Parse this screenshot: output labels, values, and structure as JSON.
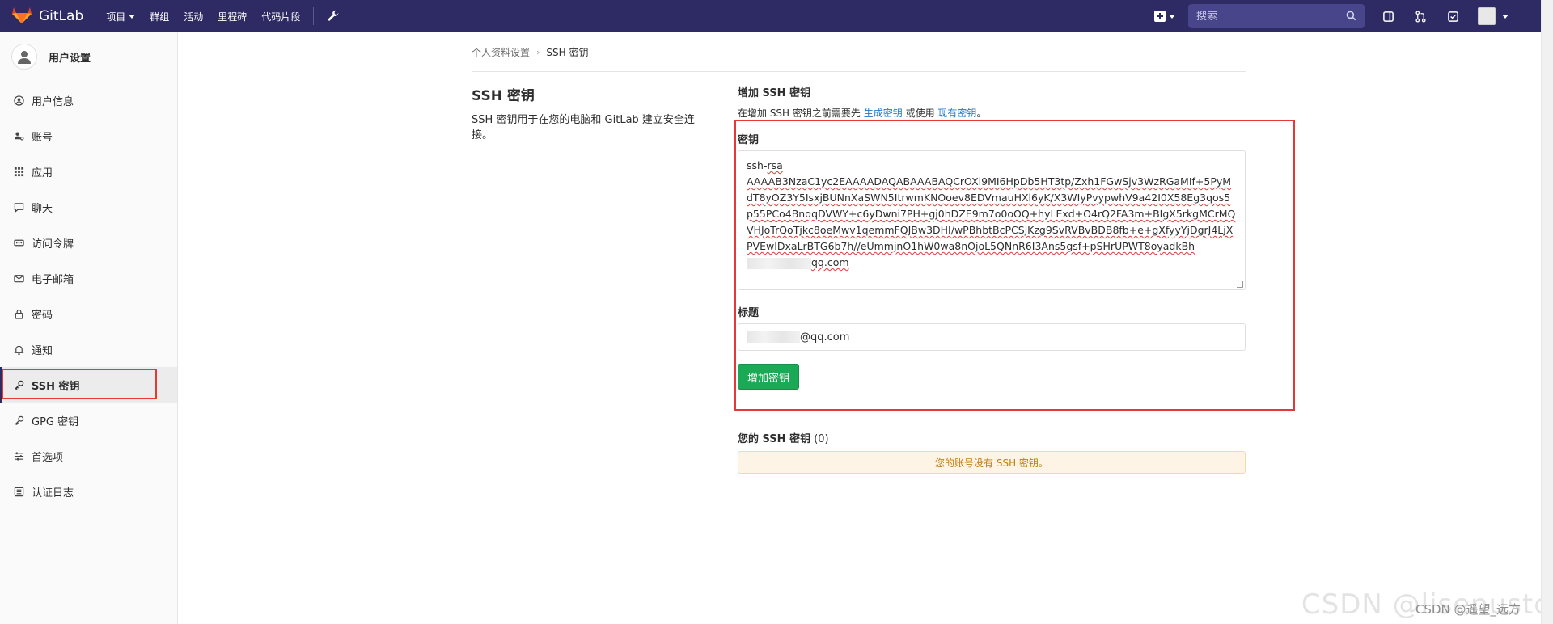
{
  "nav": {
    "brand": "GitLab",
    "items": [
      {
        "label": "项目",
        "dropdown": true
      },
      {
        "label": "群组",
        "dropdown": false
      },
      {
        "label": "活动",
        "dropdown": false
      },
      {
        "label": "里程碑",
        "dropdown": false
      },
      {
        "label": "代码片段",
        "dropdown": false
      }
    ],
    "search_placeholder": "搜索",
    "icons": [
      "gitlab-logo-icon",
      "wrench-icon",
      "plus-square-icon",
      "search-icon",
      "sidebar-toggle-icon",
      "merge-request-icon",
      "todo-check-icon",
      "avatar-icon"
    ],
    "bg_color": "#2e2a63"
  },
  "sidebar": {
    "title": "用户设置",
    "items": [
      {
        "label": "用户信息",
        "icon": "user-circle-icon",
        "active": false
      },
      {
        "label": "账号",
        "icon": "account-gears-icon",
        "active": false
      },
      {
        "label": "应用",
        "icon": "apps-grid-icon",
        "active": false
      },
      {
        "label": "聊天",
        "icon": "chat-bubble-icon",
        "active": false
      },
      {
        "label": "访问令牌",
        "icon": "token-icon",
        "active": false
      },
      {
        "label": "电子邮箱",
        "icon": "mail-icon",
        "active": false
      },
      {
        "label": "密码",
        "icon": "lock-icon",
        "active": false
      },
      {
        "label": "通知",
        "icon": "bell-icon",
        "active": false
      },
      {
        "label": "SSH 密钥",
        "icon": "key-icon",
        "active": true
      },
      {
        "label": "GPG 密钥",
        "icon": "key-icon",
        "active": false
      },
      {
        "label": "首选项",
        "icon": "sliders-icon",
        "active": false
      },
      {
        "label": "认证日志",
        "icon": "log-list-icon",
        "active": false
      }
    ]
  },
  "breadcrumb": {
    "parent": "个人资料设置",
    "separator": "›",
    "current": "SSH 密钥"
  },
  "section": {
    "title": "SSH 密钥",
    "description": "SSH 密钥用于在您的电脑和 GitLab 建立安全连接。"
  },
  "form": {
    "heading": "增加 SSH 密钥",
    "hint_prefix": "在增加 SSH 密钥之前需要先",
    "hint_link_generate": "生成密钥",
    "hint_middle": "或使用",
    "hint_link_existing": "现有密钥",
    "hint_suffix": "。",
    "key_label": "密钥",
    "key_line1_prefix": "ssh-",
    "key_line1_word": "rsa",
    "key_body": "AAAAB3NzaC1yc2EAAAADAQABAAABAQCrOXi9MI6HpDb5HT3tp/Zxh1FGwSjv3WzRGaMIf+5PyMdT8yOZ3Y5IsxjBUNnXaSWN5ItrwmKNOoev8EDVmauHXl6yK/X3WIyPvypwhV9a42I0X58Eg3qos5p55PCo4BnqqDVWY+c6yDwni7PH+gj0hDZE9m7o0oOQ+hyLExd+O4rQ2FA3m+BIgX5rkgMCrMQVHJoTrQoTjkc8oeMwv1qemmFQJBw3DHI/wPBhbtBcPCSjKzg9SvRVBvBDB8fb+e+gXfyyYjDgrJ4LjXPVEwIDxaLrBTG6b7h//eUmmjnO1hW0wa8nOjoL5QNnR6I3Ans5gsf+pSHrUPWT8oyadkBh",
    "key_email_suffix": "qq.com",
    "title_label": "标题",
    "title_value_suffix": "@qq.com",
    "submit_label": "增加密钥",
    "submit_color": "#1aaa55"
  },
  "keys": {
    "title_prefix": "您的 SSH 密钥",
    "count_text": "(0)",
    "empty_message": "您的账号没有 SSH 密钥。"
  },
  "watermark": {
    "large": "CSDN @lisenustc",
    "small": "CSDN @遥望_远方"
  },
  "colors": {
    "highlight": "#e53935",
    "link": "#1f78d1",
    "notice_bg": "#fdf4e6",
    "notice_text": "#c17d10"
  }
}
